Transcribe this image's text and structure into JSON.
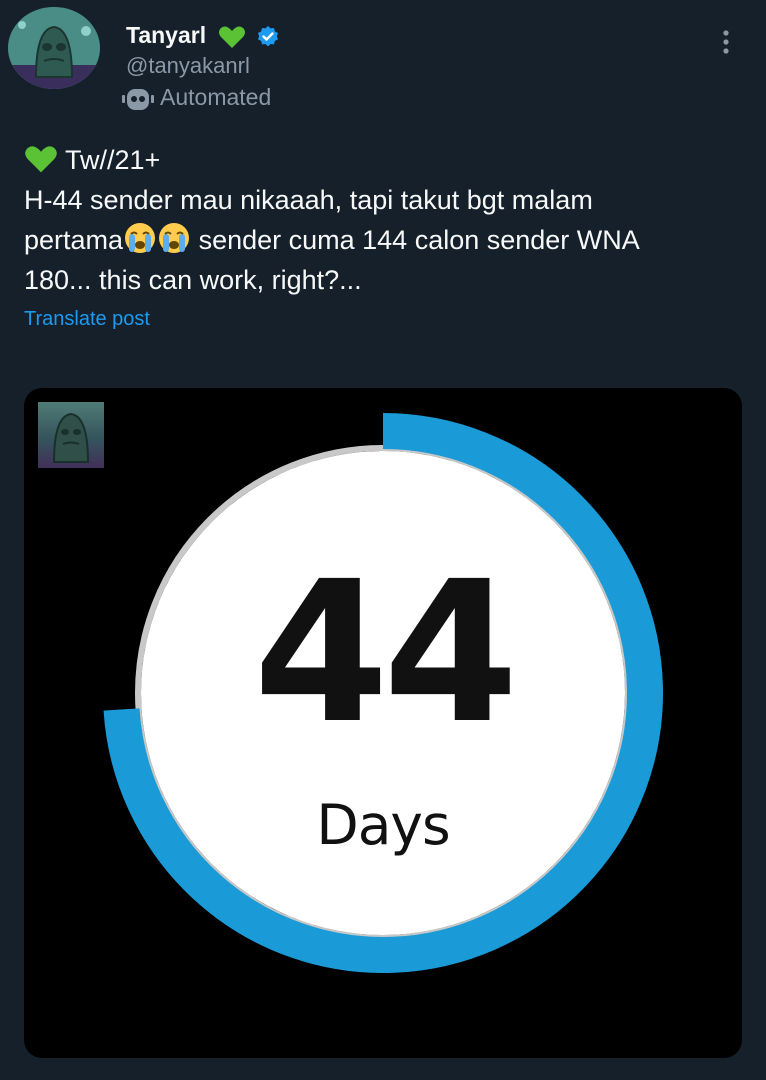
{
  "author": {
    "display_name": "Tanyarl",
    "name_emoji": "green-heart-icon",
    "verified_badge": "verified-badge-icon",
    "handle": "@tanyakanrl",
    "automated_label": "Automated",
    "automated_icon": "bot-icon"
  },
  "menu": {
    "more_icon": "more-options-icon"
  },
  "post": {
    "lines": [
      "Tw//21+",
      "H-44 sender mau nikaaah, tapi takut bgt malam",
      "pertama",
      " sender cuma 144 calon sender WNA",
      "180... this can work, right?..."
    ],
    "emojis": [
      "green-heart-icon",
      "loudly-crying-face-icon",
      "loudly-crying-face-icon"
    ],
    "translate_label": "Translate post"
  },
  "media": {
    "countdown_value": "44",
    "countdown_unit": "Days",
    "progress_fraction": 0.74,
    "colors": {
      "progress": "#1a9bd7",
      "track": "#c8c8c8",
      "face": "#ffffff",
      "background": "#000000"
    }
  },
  "theme": {
    "background": "#15202b",
    "text": "#f7f9f9",
    "muted": "#8b98a5",
    "link": "#1d9bf0"
  }
}
